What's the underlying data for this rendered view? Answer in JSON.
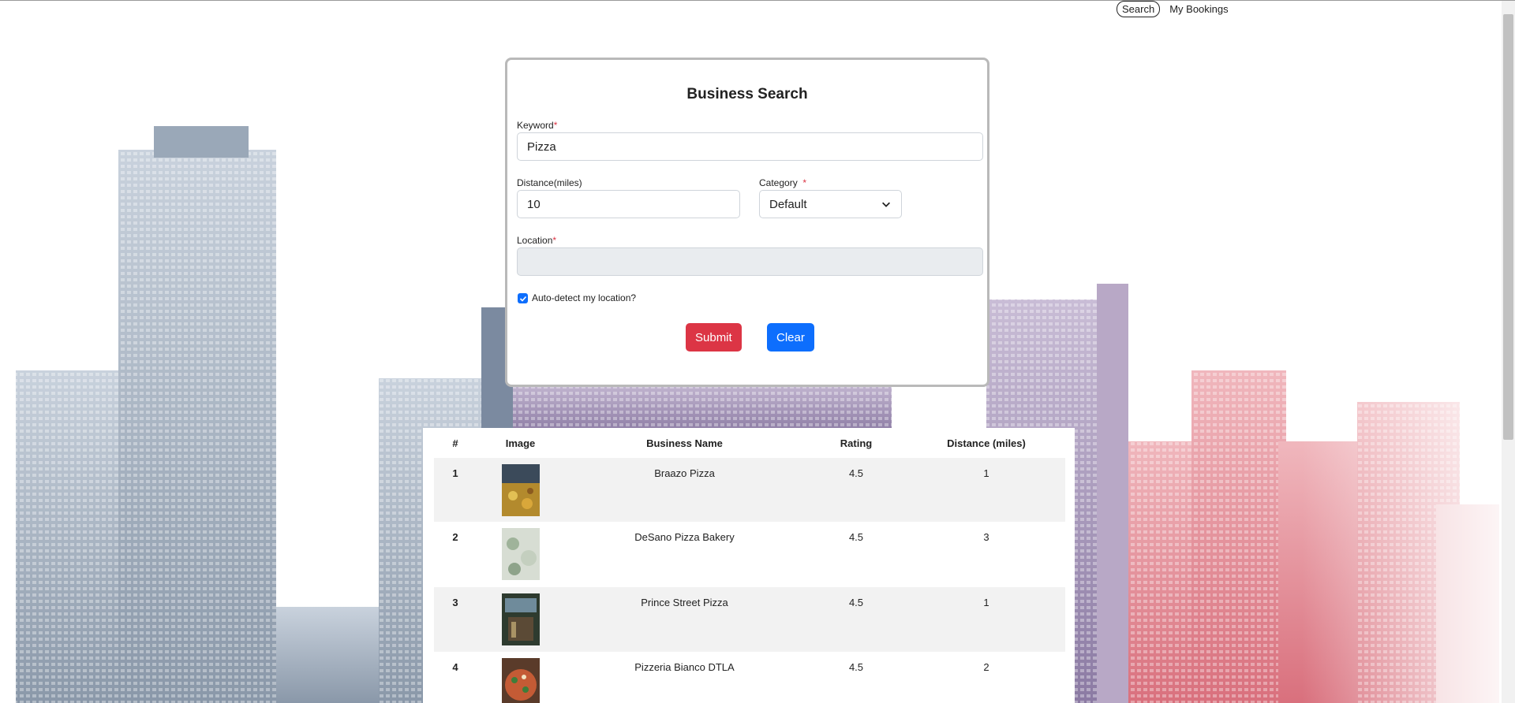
{
  "nav": {
    "items": [
      {
        "label": "Search",
        "active": true
      },
      {
        "label": "My Bookings",
        "active": false
      }
    ]
  },
  "form": {
    "title": "Business Search",
    "keyword": {
      "label": "Keyword",
      "required_mark": "*",
      "value": "Pizza"
    },
    "distance": {
      "label": "Distance(miles)",
      "value": "10"
    },
    "category": {
      "label": "Category",
      "required_mark": "*",
      "selected": "Default"
    },
    "location": {
      "label": "Location",
      "required_mark": "*",
      "value": ""
    },
    "auto_detect": {
      "label": "Auto-detect my location?",
      "checked": true
    },
    "submit_label": "Submit",
    "clear_label": "Clear"
  },
  "results": {
    "headers": [
      "#",
      "Image",
      "Business Name",
      "Rating",
      "Distance (miles)"
    ],
    "rows": [
      {
        "index": "1",
        "name": "Braazo Pizza",
        "rating": "4.5",
        "distance": "1"
      },
      {
        "index": "2",
        "name": "DeSano Pizza Bakery",
        "rating": "4.5",
        "distance": "3"
      },
      {
        "index": "3",
        "name": "Prince Street Pizza",
        "rating": "4.5",
        "distance": "1"
      },
      {
        "index": "4",
        "name": "Pizzeria Bianco DTLA",
        "rating": "4.5",
        "distance": "2"
      }
    ]
  },
  "colors": {
    "primary": "#0d6efd",
    "danger": "#dc3545",
    "border": "#b9b9b9"
  }
}
